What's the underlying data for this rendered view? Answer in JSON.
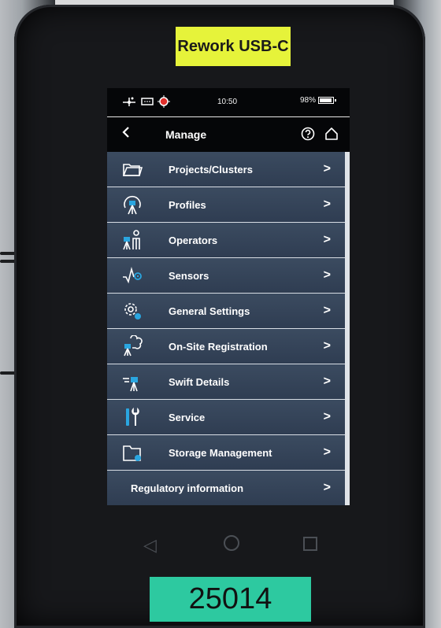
{
  "labels": {
    "top_sticker": "Rework USB-C",
    "bottom_sticker": "25014"
  },
  "status_bar": {
    "time": "10:50",
    "battery": "98%",
    "battery_level": 0.98
  },
  "header": {
    "title": "Manage",
    "back_icon": "chevron-left-icon",
    "help_icon": "question-circle-icon",
    "home_icon": "home-icon"
  },
  "menu": {
    "items": [
      {
        "label": "Projects/Clusters",
        "icon": "folder-icon"
      },
      {
        "label": "Profiles",
        "icon": "profile-icon"
      },
      {
        "label": "Operators",
        "icon": "operator-icon"
      },
      {
        "label": "Sensors",
        "icon": "sensor-icon"
      },
      {
        "label": "General Settings",
        "icon": "gear-icon"
      },
      {
        "label": "On-Site Registration",
        "icon": "registration-icon"
      },
      {
        "label": "Swift Details",
        "icon": "scanner-icon"
      },
      {
        "label": "Service",
        "icon": "tools-icon"
      },
      {
        "label": "Storage Management",
        "icon": "storage-icon"
      },
      {
        "label": "Regulatory information",
        "icon": ""
      }
    ]
  },
  "colors": {
    "menu_bg": "#334259",
    "accent": "#2aa6e0",
    "label_yellow": "#e6f33a",
    "label_teal": "#2dc9a0"
  }
}
